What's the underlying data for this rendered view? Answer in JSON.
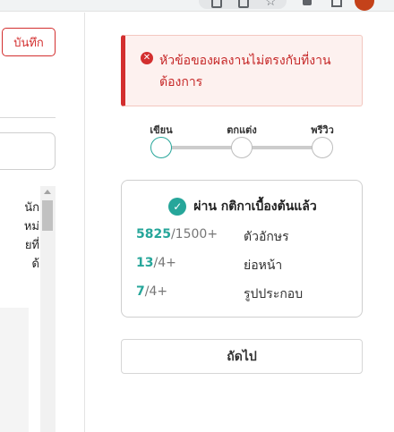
{
  "toolbar": {
    "save_label": "บันทึก"
  },
  "editor": {
    "lines": [
      "นัก",
      "หม่",
      "ยที่",
      "ด้"
    ]
  },
  "alert": {
    "message": "หัวข้อของผลงานไม่ตรงกับที่งานต้องการ",
    "icon": "error-circle-icon",
    "color": "#d32f2f"
  },
  "stepper": {
    "steps": [
      {
        "label": "เขียน",
        "active": true
      },
      {
        "label": "ตกแต่ง",
        "active": false
      },
      {
        "label": "พรีวิว",
        "active": false
      }
    ]
  },
  "criteria": {
    "title": "ผ่าน กติกาเบื้องต้นแล้ว",
    "icon": "check-circle-icon",
    "accent": "#26a69a",
    "rows": [
      {
        "value": "5825",
        "required": "/1500+",
        "label": "ตัวอักษร"
      },
      {
        "value": "13",
        "required": "/4+",
        "label": "ย่อหน้า"
      },
      {
        "value": "7",
        "required": "/4+",
        "label": "รูปประกอบ"
      }
    ]
  },
  "footer": {
    "next_label": "ถัดไป"
  }
}
